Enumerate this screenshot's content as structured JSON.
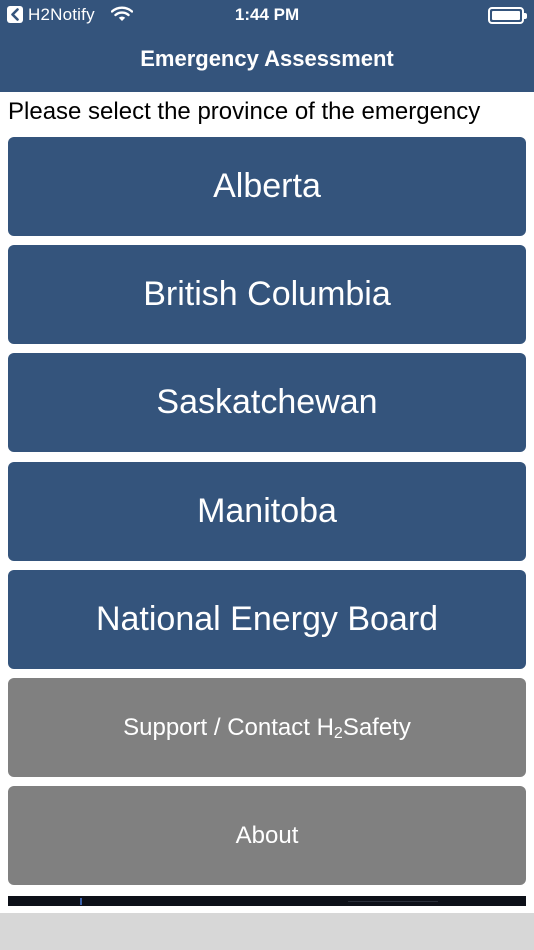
{
  "status_bar": {
    "back_app": "H2Notify",
    "time": "1:44 PM",
    "icons": [
      "back-chevron-icon",
      "wifi-icon",
      "battery-icon"
    ]
  },
  "nav": {
    "title": "Emergency Assessment"
  },
  "prompt": "Please select the province of the emergency",
  "provinces": [
    {
      "label": "Alberta"
    },
    {
      "label": "British Columbia"
    },
    {
      "label": "Saskatchewan"
    },
    {
      "label": "Manitoba"
    },
    {
      "label": "National Energy Board"
    }
  ],
  "support": {
    "prefix": "Support / Contact H",
    "subscript": "2",
    "suffix": "Safety"
  },
  "about": {
    "label": "About"
  },
  "colors": {
    "primary": "#34547c",
    "secondary": "#808080",
    "footer": "#d7d7d7"
  }
}
